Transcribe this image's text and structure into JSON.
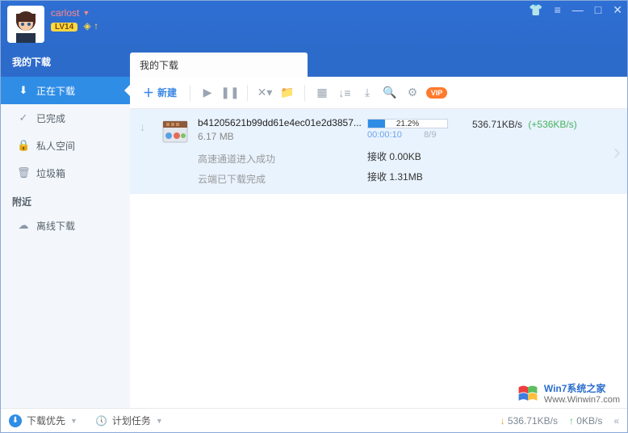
{
  "user": {
    "name": "carlost",
    "level": "LV14"
  },
  "sidebar": {
    "header": "我的下载",
    "items": [
      {
        "icon": "download",
        "label": "正在下载"
      },
      {
        "icon": "check",
        "label": "已完成"
      },
      {
        "icon": "lock",
        "label": "私人空间"
      },
      {
        "icon": "trash",
        "label": "垃圾箱"
      }
    ],
    "sub_header": "附近",
    "sub_items": [
      {
        "icon": "cloud",
        "label": "离线下载"
      }
    ]
  },
  "tab": {
    "title": "我的下载"
  },
  "toolbar": {
    "new_label": "新建"
  },
  "task": {
    "filename": "b41205621b99dd61e4ec01e2d3857...",
    "size": "6.17 MB",
    "line1": "高速通道进入成功",
    "line2": "云端已下载完成",
    "percent": "21.2%",
    "percent_num": 21.2,
    "elapsed": "00:00:10",
    "fraction": "8/9",
    "rx1_label": "接收",
    "rx1_val": "0.00KB",
    "rx2_label": "接收",
    "rx2_val": "1.31MB",
    "speed": "536.71KB/s",
    "boost": "(+536KB/s)"
  },
  "statusbar": {
    "left1": "下载优先",
    "left2": "计划任务",
    "down": "536.71KB/s",
    "up": "0KB/s"
  },
  "watermark": {
    "t1": "Win7系统之家",
    "t2": "Www.Winwin7.com"
  }
}
